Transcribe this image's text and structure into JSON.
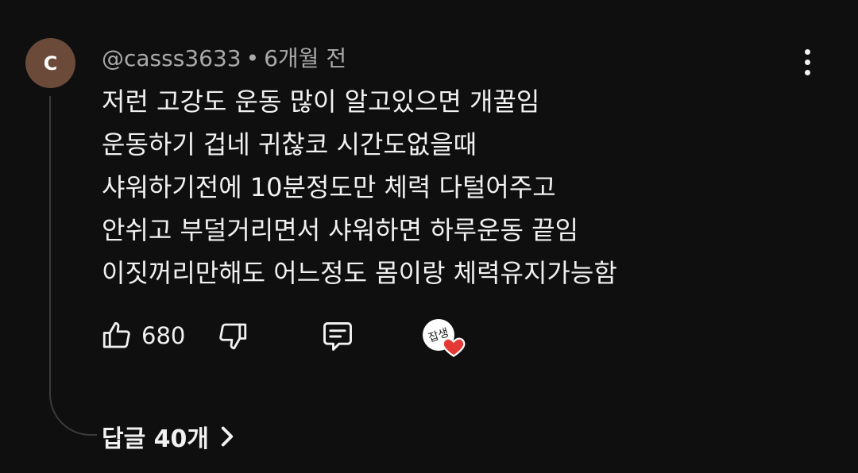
{
  "comment": {
    "avatar_letter": "C",
    "author": "@casss3633",
    "separator": "•",
    "time": "6개월 전",
    "lines": [
      "저런 고강도 운동 많이 알고있으면 개꿀임",
      "운동하기 겁네 귀찮코 시간도없을때",
      "샤워하기전에 10분정도만 체력 다털어주고",
      "안쉬고 부덜거리면서 샤워하면 하루운동 끝임",
      "이짓꺼리만해도 어느정도 몸이랑 체력유지가능함"
    ],
    "like_count": "680",
    "creator_avatar_text": "잡생",
    "replies_label": "답글 40개"
  },
  "colors": {
    "background": "#0f0f0f",
    "text": "#f1f1f1",
    "secondary_text": "#aaaaaa",
    "avatar_bg": "#6b4a3a",
    "heart": "#e53935"
  },
  "icons": [
    "more-vert-icon",
    "thumb-up-icon",
    "thumb-down-icon",
    "reply-icon",
    "heart-icon",
    "chevron-right-icon"
  ]
}
